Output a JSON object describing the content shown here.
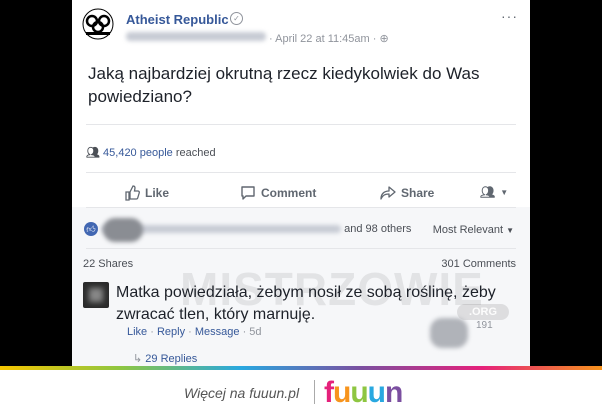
{
  "post": {
    "page_name": "Atheist Republic",
    "date": "· April 22 at 11:45am ·",
    "more_menu": "···",
    "text": "Jaką najbardziej okrutną rzecz kiedykolwiek do Was powiedziano?",
    "reach_count": "45,420 people",
    "reach_suffix": "reached"
  },
  "actions": {
    "like": "Like",
    "comment": "Comment",
    "share": "Share"
  },
  "reactions": {
    "others": "and 98 others",
    "sort": "Most Relevant"
  },
  "stats": {
    "shares": "22 Shares",
    "comments": "301 Comments"
  },
  "comment": {
    "text": "Matka powiedziała, żebym nosił ze sobą roślinę, żeby zwracać tlen, który marnuję.",
    "like": "Like",
    "reply": "Reply",
    "message": "Message",
    "time": "5d",
    "likes_badge": "191",
    "replies": "29 Replies"
  },
  "watermark": {
    "text": "MISTRZOWIE",
    "org": ".ORG"
  },
  "footer": {
    "more_text": "Więcej na fuuun.pl",
    "logo": [
      "f",
      "u",
      "u",
      "u",
      "n"
    ],
    "logo_colors": [
      "#e5217b",
      "#f7941d",
      "#8ec641",
      "#29a8e0",
      "#7b4fa0"
    ]
  },
  "colors": {
    "link": "#365899",
    "like_blue": "#4267b2"
  },
  "icons": [
    "logo-icon",
    "verified-icon",
    "globe-icon",
    "people-icon",
    "thumbs-up-icon",
    "comment-icon",
    "share-icon",
    "audience-icon",
    "reply-arrow-icon"
  ]
}
